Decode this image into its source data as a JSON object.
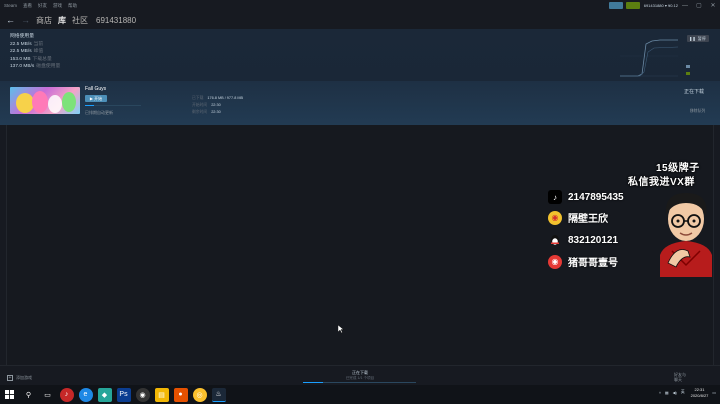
{
  "menubar": {
    "items": [
      "Steam",
      "查看",
      "好友",
      "游戏",
      "帮助"
    ]
  },
  "topright": {
    "account": "691431880 ▾ ¥0.12",
    "minimize": "—",
    "maximize": "▢",
    "close": "✕"
  },
  "nav": {
    "back": "←",
    "forward": "→",
    "store": "商店",
    "library": "库",
    "community": "社区",
    "username": "691431880"
  },
  "network": {
    "heading": "网络使用量",
    "rows": [
      {
        "value": "22.5 MB/s",
        "label": "当前"
      },
      {
        "value": "22.5 MB/s",
        "label": "峰值"
      },
      {
        "value": "153.0 MB",
        "label": "下载总量"
      },
      {
        "value": "137.0 MB/s",
        "label": "磁盘使用量"
      }
    ],
    "pause_label": "暂停"
  },
  "download": {
    "title": "Fall Guys",
    "play_label": "▶ 开始",
    "progress": 0.16,
    "status": "已排期自动更新",
    "stats": [
      {
        "key": "已下载",
        "value": "176.8 MB / 977.8 MB"
      },
      {
        "key": "开始时间",
        "value": "22:30"
      },
      {
        "key": "剩余时间",
        "value": "22:30"
      }
    ],
    "state_label": "正在下载",
    "remove_label": "移除队列"
  },
  "footer": {
    "add_game": "添加游戏",
    "status_title": "正在下载",
    "status_sub": "已完成 1/1 个项目",
    "progress": 0.18,
    "friends_line1": "好友与",
    "friends_line2": "聊天"
  },
  "taskbar": {
    "time": "22:31",
    "date": "2020/8/27",
    "tray_lang": "英"
  },
  "overlay": {
    "title_line1": "15级牌子",
    "title_line2": "私信我进VX群",
    "rows": [
      {
        "icon": "tiktok-icon",
        "text": "2147895435"
      },
      {
        "icon": "weibo-icon",
        "text": "隔壁王欣"
      },
      {
        "icon": "qq-icon",
        "text": "832120121"
      },
      {
        "icon": "netease-icon",
        "text": "猪哥哥壹号"
      }
    ]
  },
  "colors": {
    "accent": "#1a9fff",
    "bg": "#171a21",
    "panel": "#1b2838",
    "green": "#5c7e10"
  }
}
